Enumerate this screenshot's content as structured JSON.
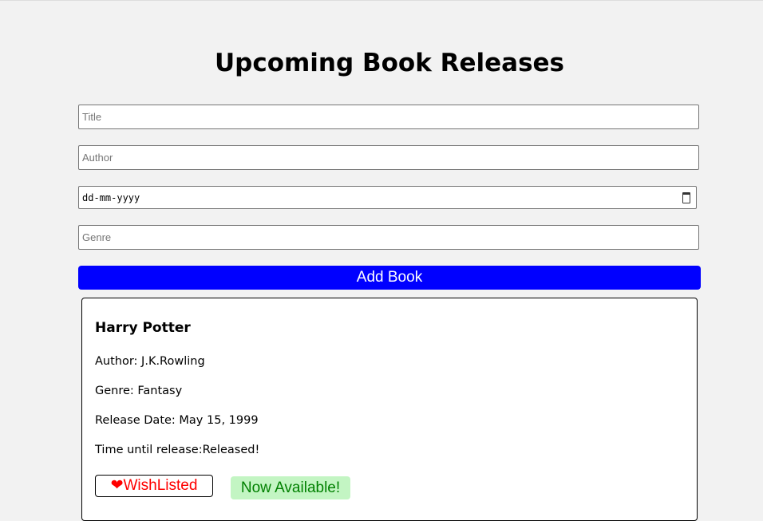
{
  "page_title": "Upcoming Book Releases",
  "form": {
    "title_placeholder": "Title",
    "author_placeholder": "Author",
    "date_placeholder": "dd-mm-yyyy",
    "genre_placeholder": "Genre",
    "add_button": "Add Book"
  },
  "books": [
    {
      "title": "Harry Potter",
      "author": "Author: J.K.Rowling",
      "genre": "Genre: Fantasy",
      "release_date": "Release Date: May 15, 1999",
      "time_until": "Time until release:Released!",
      "wishlist_icon": "❤",
      "wishlist_label": "WishListed",
      "status": "Now Available!"
    }
  ]
}
